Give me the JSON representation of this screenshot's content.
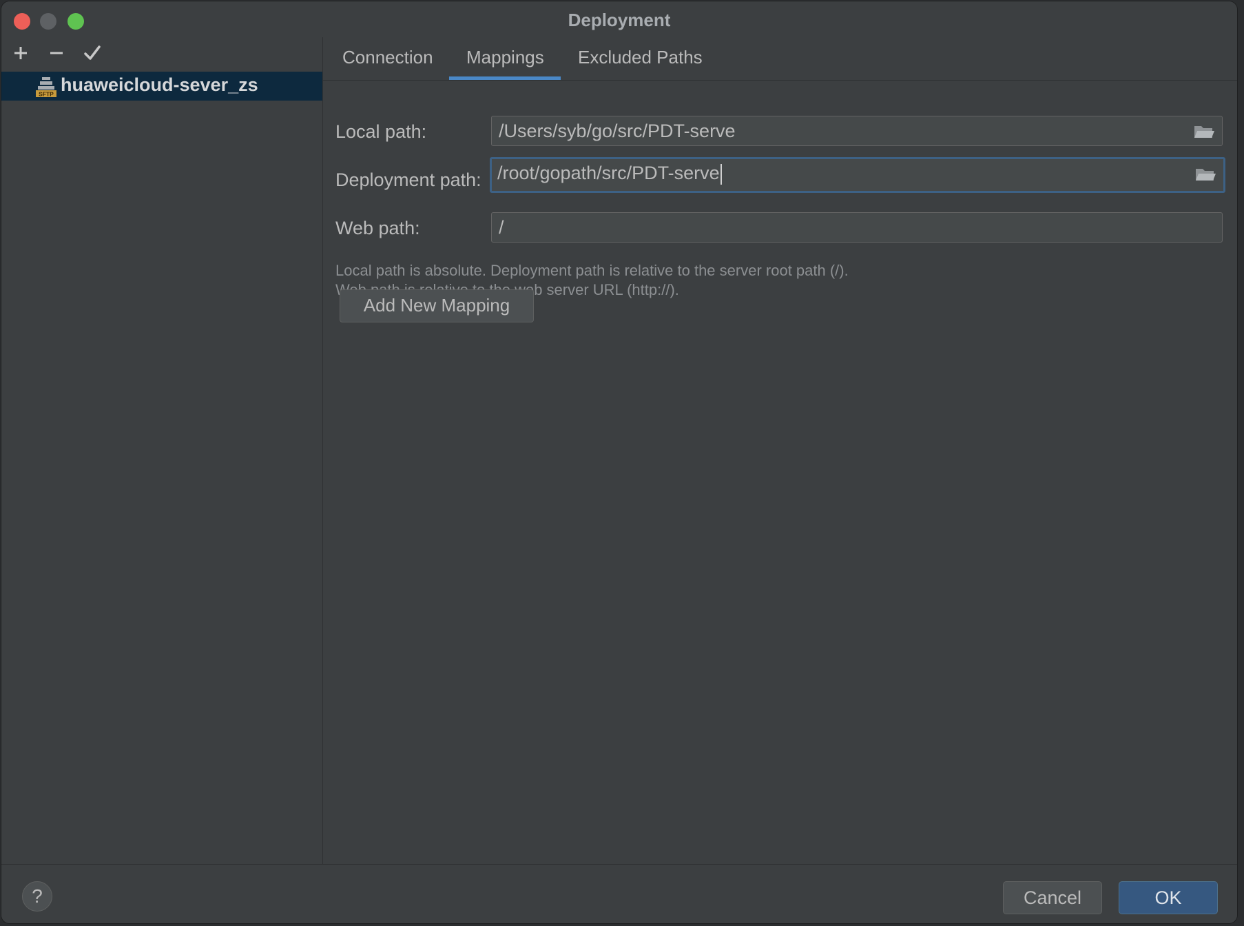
{
  "window": {
    "title": "Deployment"
  },
  "left_toolbar": {
    "add_icon": "plus-icon",
    "remove_icon": "minus-icon",
    "apply_icon": "check-icon"
  },
  "servers": [
    {
      "label": "huaweicloud-sever_zs",
      "icon": "sftp-server-icon",
      "icon_text": "SFTP"
    }
  ],
  "tabs": [
    {
      "label": "Connection"
    },
    {
      "label": "Mappings"
    },
    {
      "label": "Excluded Paths"
    }
  ],
  "active_tab": "Mappings",
  "mapping": {
    "local_path_label": "Local path:",
    "local_path_value": "/Users/syb/go/src/PDT-serve",
    "deployment_path_label": "Deployment path:",
    "deployment_path_value": "/root/gopath/src/PDT-serve",
    "web_path_label": "Web path:",
    "web_path_value": "/"
  },
  "help_text": {
    "line1": "Local path is absolute. Deployment path is relative to the server root path (/).",
    "line2": "Web path is relative to the web server URL (http://)."
  },
  "add_mapping_label": "Add New Mapping",
  "footer": {
    "help_label": "?",
    "cancel_label": "Cancel",
    "ok_label": "OK"
  },
  "colors": {
    "accent": "#4a88c7",
    "selection": "#0d293e",
    "ok_button": "#365880"
  }
}
